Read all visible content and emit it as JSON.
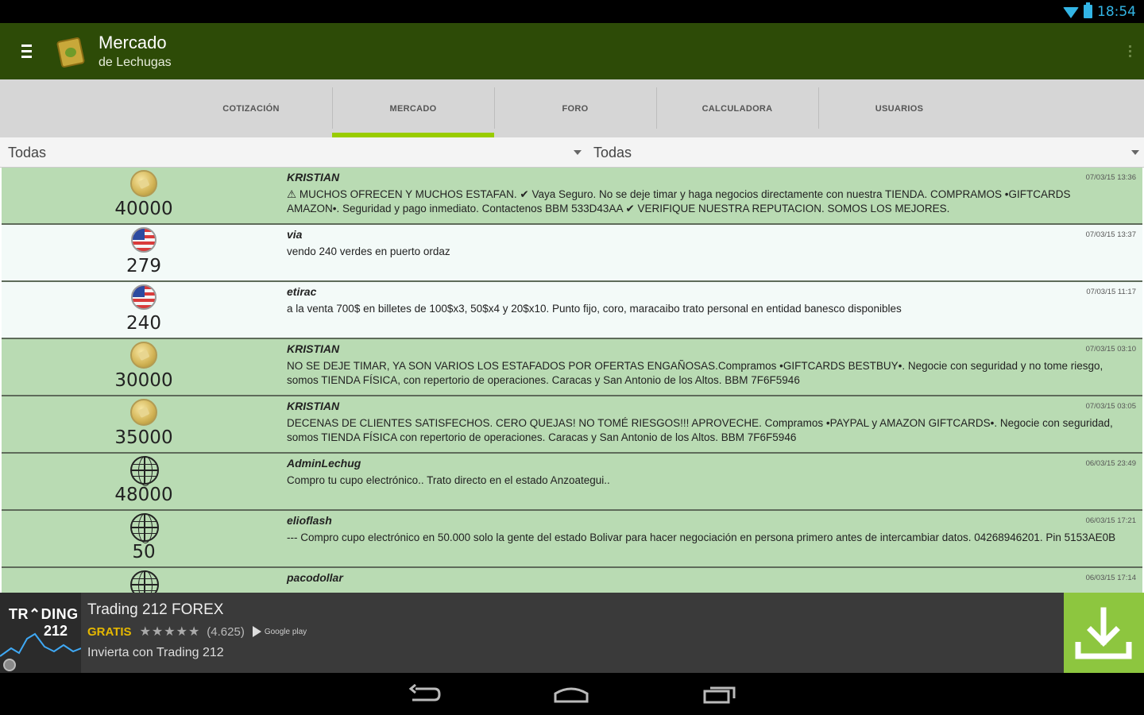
{
  "status": {
    "time": "18:54"
  },
  "app": {
    "title": "Mercado",
    "subtitle": "de Lechugas"
  },
  "tabs": [
    {
      "label": "COTIZACIÓN",
      "active": false
    },
    {
      "label": "MERCADO",
      "active": true
    },
    {
      "label": "FORO",
      "active": false
    },
    {
      "label": "CALCULADORA",
      "active": false
    },
    {
      "label": "USUARIOS",
      "active": false
    }
  ],
  "filters": [
    {
      "value": "Todas"
    },
    {
      "value": "Todas"
    }
  ],
  "colors": {
    "action_bar": "#2d4b07",
    "tab_indicator": "#99cc00",
    "row_green": "#b9dbb3",
    "row_white": "#f3faf8",
    "ad_download": "#8dc63f",
    "status_accent": "#33b5e5"
  },
  "posts": [
    {
      "icon": "coin-icon",
      "amount": "40000",
      "user": "KRISTIAN",
      "date": "07/03/15 13:36",
      "tone": "green",
      "message": "⚠ MUCHOS OFRECEN Y MUCHOS ESTAFAN. ✔ Vaya Seguro. No se deje timar y haga negocios directamente con nuestra TIENDA. COMPRAMOS •GIFTCARDS AMAZON•. Seguridad y pago inmediato. Contactenos BBM 533D43AA ✔ VERIFIQUE NUESTRA REPUTACION. SOMOS LOS MEJORES."
    },
    {
      "icon": "flag-icon",
      "amount": "279",
      "user": "via",
      "date": "07/03/15 13:37",
      "tone": "white",
      "message": "vendo 240 verdes en puerto ordaz"
    },
    {
      "icon": "flag-icon",
      "amount": "240",
      "user": "etirac",
      "date": "07/03/15 11:17",
      "tone": "white",
      "message": "a la venta 700$ en billetes de 100$x3,  50$x4 y 20$x10. Punto fijo, coro, maracaibo trato personal en entidad banesco disponibles"
    },
    {
      "icon": "coin-icon",
      "amount": "30000",
      "user": "KRISTIAN",
      "date": "07/03/15 03:10",
      "tone": "green",
      "message": "NO SE DEJE TIMAR, YA SON VARIOS LOS ESTAFADOS POR OFERTAS ENGAÑOSAS.Compramos •GIFTCARDS BESTBUY•. Negocie con  seguridad y no tome riesgo, somos TIENDA FÍSICA, con repertorio de operaciones. Caracas y San Antonio de los Altos. BBM 7F6F5946"
    },
    {
      "icon": "coin-icon",
      "amount": "35000",
      "user": "KRISTIAN",
      "date": "07/03/15 03:05",
      "tone": "green",
      "message": "DECENAS DE CLIENTES SATISFECHOS. CERO QUEJAS! NO TOMÉ RIESGOS!!! APROVECHE. Compramos •PAYPAL y AMAZON GIFTCARDS•. Negocie con seguridad, somos TIENDA FÍSICA con repertorio de operaciones. Caracas y San Antonio de los Altos. BBM 7F6F5946"
    },
    {
      "icon": "globe-icon",
      "amount": "48000",
      "user": "AdminLechug",
      "date": "06/03/15 23:49",
      "tone": "green",
      "message": "Compro tu cupo electrónico.. Trato directo en el estado Anzoategui.."
    },
    {
      "icon": "globe-icon",
      "amount": "50",
      "user": "elioflash",
      "date": "06/03/15 17:21",
      "tone": "green",
      "message": "--- Compro cupo electrónico en 50.000 solo la gente del estado Bolivar para hacer negociación en persona primero antes de intercambiar datos. 04268946201. Pin 5153AE0B"
    },
    {
      "icon": "globe-icon",
      "amount": "",
      "user": "pacodollar",
      "date": "06/03/15 17:14",
      "tone": "green",
      "message": ""
    }
  ],
  "ad": {
    "logo_line1": "TR⌃DING",
    "logo_line2": "212",
    "title": "Trading 212 FOREX",
    "free_label": "GRATIS",
    "stars": "★★★★★",
    "rating": "(4.625)",
    "store_label": "Google play",
    "subtitle": "Invierta con Trading 212"
  }
}
